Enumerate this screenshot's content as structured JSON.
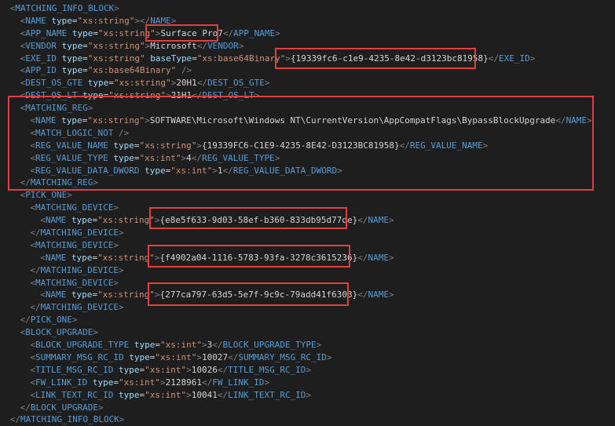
{
  "lines": [
    {
      "indent": 1,
      "segs": [
        [
          "p",
          "<"
        ],
        [
          "t",
          "MATCHING_INFO_BLOCK"
        ],
        [
          "p",
          ">"
        ]
      ]
    },
    {
      "indent": 2,
      "segs": [
        [
          "p",
          "<"
        ],
        [
          "t",
          "NAME"
        ],
        [
          "x",
          " "
        ],
        [
          "a",
          "type"
        ],
        [
          "x",
          "="
        ],
        [
          "s",
          "\"xs:string\""
        ],
        [
          "p",
          "></"
        ],
        [
          "t",
          "NAME"
        ],
        [
          "p",
          ">"
        ]
      ]
    },
    {
      "indent": 2,
      "segs": [
        [
          "p",
          "<"
        ],
        [
          "t",
          "APP_NAME"
        ],
        [
          "x",
          " "
        ],
        [
          "a",
          "type"
        ],
        [
          "x",
          "="
        ],
        [
          "s",
          "\"xs:string\""
        ],
        [
          "p",
          ">"
        ],
        [
          "x",
          "Surface Pro7"
        ],
        [
          "p",
          "</"
        ],
        [
          "t",
          "APP_NAME"
        ],
        [
          "p",
          ">"
        ]
      ]
    },
    {
      "indent": 2,
      "segs": [
        [
          "p",
          "<"
        ],
        [
          "t",
          "VENDOR"
        ],
        [
          "x",
          " "
        ],
        [
          "a",
          "type"
        ],
        [
          "x",
          "="
        ],
        [
          "s",
          "\"xs:string\""
        ],
        [
          "p",
          ">"
        ],
        [
          "x",
          "Microsoft"
        ],
        [
          "p",
          "</"
        ],
        [
          "t",
          "VENDOR"
        ],
        [
          "p",
          ">"
        ]
      ]
    },
    {
      "indent": 2,
      "segs": [
        [
          "p",
          "<"
        ],
        [
          "t",
          "EXE_ID"
        ],
        [
          "x",
          " "
        ],
        [
          "a",
          "type"
        ],
        [
          "x",
          "="
        ],
        [
          "s",
          "\"xs:string\""
        ],
        [
          "x",
          " "
        ],
        [
          "a",
          "baseType"
        ],
        [
          "x",
          "="
        ],
        [
          "s",
          "\"xs:base64Binary\""
        ],
        [
          "p",
          ">"
        ],
        [
          "x",
          "{19339fc6-c1e9-4235-8e42-d3123bc81958}"
        ],
        [
          "p",
          "</"
        ],
        [
          "t",
          "EXE_ID"
        ],
        [
          "p",
          ">"
        ]
      ]
    },
    {
      "indent": 2,
      "segs": [
        [
          "p",
          "<"
        ],
        [
          "t",
          "APP_ID"
        ],
        [
          "x",
          " "
        ],
        [
          "a",
          "type"
        ],
        [
          "x",
          "="
        ],
        [
          "s",
          "\"xs:base64Binary\""
        ],
        [
          "x",
          " "
        ],
        [
          "p",
          "/>"
        ]
      ]
    },
    {
      "indent": 2,
      "segs": [
        [
          "p",
          "<"
        ],
        [
          "t",
          "DEST_OS_GTE"
        ],
        [
          "x",
          " "
        ],
        [
          "a",
          "type"
        ],
        [
          "x",
          "="
        ],
        [
          "s",
          "\"xs:string\""
        ],
        [
          "p",
          ">"
        ],
        [
          "x",
          "20H1"
        ],
        [
          "p",
          "</"
        ],
        [
          "t",
          "DEST_OS_GTE"
        ],
        [
          "p",
          ">"
        ]
      ]
    },
    {
      "indent": 2,
      "segs": [
        [
          "p",
          "<"
        ],
        [
          "t",
          "DEST_OS_LT"
        ],
        [
          "x",
          " "
        ],
        [
          "a",
          "type"
        ],
        [
          "x",
          "="
        ],
        [
          "s",
          "\"xs:string\""
        ],
        [
          "p",
          ">"
        ],
        [
          "x",
          "21H1"
        ],
        [
          "p",
          "</"
        ],
        [
          "t",
          "DEST_OS_LT"
        ],
        [
          "p",
          ">"
        ]
      ]
    },
    {
      "indent": 2,
      "segs": [
        [
          "p",
          "<"
        ],
        [
          "t",
          "MATCHING_REG"
        ],
        [
          "p",
          ">"
        ]
      ]
    },
    {
      "indent": 3,
      "segs": [
        [
          "p",
          "<"
        ],
        [
          "t",
          "NAME"
        ],
        [
          "x",
          " "
        ],
        [
          "a",
          "type"
        ],
        [
          "x",
          "="
        ],
        [
          "s",
          "\"xs:string\""
        ],
        [
          "p",
          ">"
        ],
        [
          "x",
          "SOFTWARE\\Microsoft\\Windows NT\\CurrentVersion\\AppCompatFlags\\BypassBlockUpgrade"
        ],
        [
          "p",
          "</"
        ],
        [
          "t",
          "NAME"
        ],
        [
          "p",
          ">"
        ]
      ]
    },
    {
      "indent": 3,
      "segs": [
        [
          "p",
          "<"
        ],
        [
          "t",
          "MATCH_LOGIC_NOT"
        ],
        [
          "x",
          " "
        ],
        [
          "p",
          "/>"
        ]
      ]
    },
    {
      "indent": 3,
      "segs": [
        [
          "p",
          "<"
        ],
        [
          "t",
          "REG_VALUE_NAME"
        ],
        [
          "x",
          " "
        ],
        [
          "a",
          "type"
        ],
        [
          "x",
          "="
        ],
        [
          "s",
          "\"xs:string\""
        ],
        [
          "p",
          ">"
        ],
        [
          "x",
          "{19339FC6-C1E9-4235-8E42-D3123BC81958}"
        ],
        [
          "p",
          "</"
        ],
        [
          "t",
          "REG_VALUE_NAME"
        ],
        [
          "p",
          ">"
        ]
      ]
    },
    {
      "indent": 3,
      "segs": [
        [
          "p",
          "<"
        ],
        [
          "t",
          "REG_VALUE_TYPE"
        ],
        [
          "x",
          " "
        ],
        [
          "a",
          "type"
        ],
        [
          "x",
          "="
        ],
        [
          "s",
          "\"xs:int\""
        ],
        [
          "p",
          ">"
        ],
        [
          "x",
          "4"
        ],
        [
          "p",
          "</"
        ],
        [
          "t",
          "REG_VALUE_TYPE"
        ],
        [
          "p",
          ">"
        ]
      ]
    },
    {
      "indent": 3,
      "segs": [
        [
          "p",
          "<"
        ],
        [
          "t",
          "REG_VALUE_DATA_DWORD"
        ],
        [
          "x",
          " "
        ],
        [
          "a",
          "type"
        ],
        [
          "x",
          "="
        ],
        [
          "s",
          "\"xs:int\""
        ],
        [
          "p",
          ">"
        ],
        [
          "x",
          "1"
        ],
        [
          "p",
          "</"
        ],
        [
          "t",
          "REG_VALUE_DATA_DWORD"
        ],
        [
          "p",
          ">"
        ]
      ]
    },
    {
      "indent": 2,
      "segs": [
        [
          "p",
          "</"
        ],
        [
          "t",
          "MATCHING_REG"
        ],
        [
          "p",
          ">"
        ]
      ]
    },
    {
      "indent": 2,
      "segs": [
        [
          "p",
          "<"
        ],
        [
          "t",
          "PICK_ONE"
        ],
        [
          "p",
          ">"
        ]
      ]
    },
    {
      "indent": 3,
      "segs": [
        [
          "p",
          "<"
        ],
        [
          "t",
          "MATCHING_DEVICE"
        ],
        [
          "p",
          ">"
        ]
      ]
    },
    {
      "indent": 4,
      "segs": [
        [
          "p",
          "<"
        ],
        [
          "t",
          "NAME"
        ],
        [
          "x",
          " "
        ],
        [
          "a",
          "type"
        ],
        [
          "x",
          "="
        ],
        [
          "s",
          "\"xs:string\""
        ],
        [
          "p",
          ">"
        ],
        [
          "x",
          "{e8e5f633-9d03-58ef-b360-833db95d77de}"
        ],
        [
          "p",
          "</"
        ],
        [
          "t",
          "NAME"
        ],
        [
          "p",
          ">"
        ]
      ]
    },
    {
      "indent": 3,
      "segs": [
        [
          "p",
          "</"
        ],
        [
          "t",
          "MATCHING_DEVICE"
        ],
        [
          "p",
          ">"
        ]
      ]
    },
    {
      "indent": 3,
      "segs": [
        [
          "p",
          "<"
        ],
        [
          "t",
          "MATCHING_DEVICE"
        ],
        [
          "p",
          ">"
        ]
      ]
    },
    {
      "indent": 4,
      "segs": [
        [
          "p",
          "<"
        ],
        [
          "t",
          "NAME"
        ],
        [
          "x",
          " "
        ],
        [
          "a",
          "type"
        ],
        [
          "x",
          "="
        ],
        [
          "s",
          "\"xs:string\""
        ],
        [
          "p",
          ">"
        ],
        [
          "x",
          "{f4902a04-1116-5783-93fa-3278c3615236}"
        ],
        [
          "p",
          "</"
        ],
        [
          "t",
          "NAME"
        ],
        [
          "p",
          ">"
        ]
      ]
    },
    {
      "indent": 3,
      "segs": [
        [
          "p",
          "</"
        ],
        [
          "t",
          "MATCHING_DEVICE"
        ],
        [
          "p",
          ">"
        ]
      ]
    },
    {
      "indent": 3,
      "segs": [
        [
          "p",
          "<"
        ],
        [
          "t",
          "MATCHING_DEVICE"
        ],
        [
          "p",
          ">"
        ]
      ]
    },
    {
      "indent": 4,
      "segs": [
        [
          "p",
          "<"
        ],
        [
          "t",
          "NAME"
        ],
        [
          "x",
          " "
        ],
        [
          "a",
          "type"
        ],
        [
          "x",
          "="
        ],
        [
          "s",
          "\"xs:string\""
        ],
        [
          "p",
          ">"
        ],
        [
          "x",
          "{277ca797-63d5-5e7f-9c9c-79add41f6303}"
        ],
        [
          "p",
          "</"
        ],
        [
          "t",
          "NAME"
        ],
        [
          "p",
          ">"
        ]
      ]
    },
    {
      "indent": 3,
      "segs": [
        [
          "p",
          "</"
        ],
        [
          "t",
          "MATCHING_DEVICE"
        ],
        [
          "p",
          ">"
        ]
      ]
    },
    {
      "indent": 2,
      "segs": [
        [
          "p",
          "</"
        ],
        [
          "t",
          "PICK_ONE"
        ],
        [
          "p",
          ">"
        ]
      ]
    },
    {
      "indent": 2,
      "segs": [
        [
          "p",
          "<"
        ],
        [
          "t",
          "BLOCK_UPGRADE"
        ],
        [
          "p",
          ">"
        ]
      ]
    },
    {
      "indent": 3,
      "segs": [
        [
          "p",
          "<"
        ],
        [
          "t",
          "BLOCK_UPGRADE_TYPE"
        ],
        [
          "x",
          " "
        ],
        [
          "a",
          "type"
        ],
        [
          "x",
          "="
        ],
        [
          "s",
          "\"xs:int\""
        ],
        [
          "p",
          ">"
        ],
        [
          "x",
          "3"
        ],
        [
          "p",
          "</"
        ],
        [
          "t",
          "BLOCK_UPGRADE_TYPE"
        ],
        [
          "p",
          ">"
        ]
      ]
    },
    {
      "indent": 3,
      "segs": [
        [
          "p",
          "<"
        ],
        [
          "t",
          "SUMMARY_MSG_RC_ID"
        ],
        [
          "x",
          " "
        ],
        [
          "a",
          "type"
        ],
        [
          "x",
          "="
        ],
        [
          "s",
          "\"xs:int\""
        ],
        [
          "p",
          ">"
        ],
        [
          "x",
          "10027"
        ],
        [
          "p",
          "</"
        ],
        [
          "t",
          "SUMMARY_MSG_RC_ID"
        ],
        [
          "p",
          ">"
        ]
      ]
    },
    {
      "indent": 3,
      "segs": [
        [
          "p",
          "<"
        ],
        [
          "t",
          "TITLE_MSG_RC_ID"
        ],
        [
          "x",
          " "
        ],
        [
          "a",
          "type"
        ],
        [
          "x",
          "="
        ],
        [
          "s",
          "\"xs:int\""
        ],
        [
          "p",
          ">"
        ],
        [
          "x",
          "10026"
        ],
        [
          "p",
          "</"
        ],
        [
          "t",
          "TITLE_MSG_RC_ID"
        ],
        [
          "p",
          ">"
        ]
      ]
    },
    {
      "indent": 3,
      "segs": [
        [
          "p",
          "<"
        ],
        [
          "t",
          "FW_LINK_ID"
        ],
        [
          "x",
          " "
        ],
        [
          "a",
          "type"
        ],
        [
          "x",
          "="
        ],
        [
          "s",
          "\"xs:int\""
        ],
        [
          "p",
          ">"
        ],
        [
          "x",
          "2128961"
        ],
        [
          "p",
          "</"
        ],
        [
          "t",
          "FW_LINK_ID"
        ],
        [
          "p",
          ">"
        ]
      ]
    },
    {
      "indent": 3,
      "segs": [
        [
          "p",
          "<"
        ],
        [
          "t",
          "LINK_TEXT_RC_ID"
        ],
        [
          "x",
          " "
        ],
        [
          "a",
          "type"
        ],
        [
          "x",
          "="
        ],
        [
          "s",
          "\"xs:int\""
        ],
        [
          "p",
          ">"
        ],
        [
          "x",
          "10041"
        ],
        [
          "p",
          "</"
        ],
        [
          "t",
          "LINK_TEXT_RC_ID"
        ],
        [
          "p",
          ">"
        ]
      ]
    },
    {
      "indent": 2,
      "segs": [
        [
          "p",
          "</"
        ],
        [
          "t",
          "BLOCK_UPGRADE"
        ],
        [
          "p",
          ">"
        ]
      ]
    },
    {
      "indent": 1,
      "segs": [
        [
          "p",
          "</"
        ],
        [
          "t",
          "MATCHING_INFO_BLOCK"
        ],
        [
          "p",
          ">"
        ]
      ]
    }
  ],
  "colors": {
    "background": "#1e1e1e",
    "tag": "#569cd6",
    "attribute": "#9cdcfe",
    "string": "#ce9178",
    "text": "#d4d4d4",
    "punctuation": "#808080",
    "highlight_box": "#e04040"
  }
}
